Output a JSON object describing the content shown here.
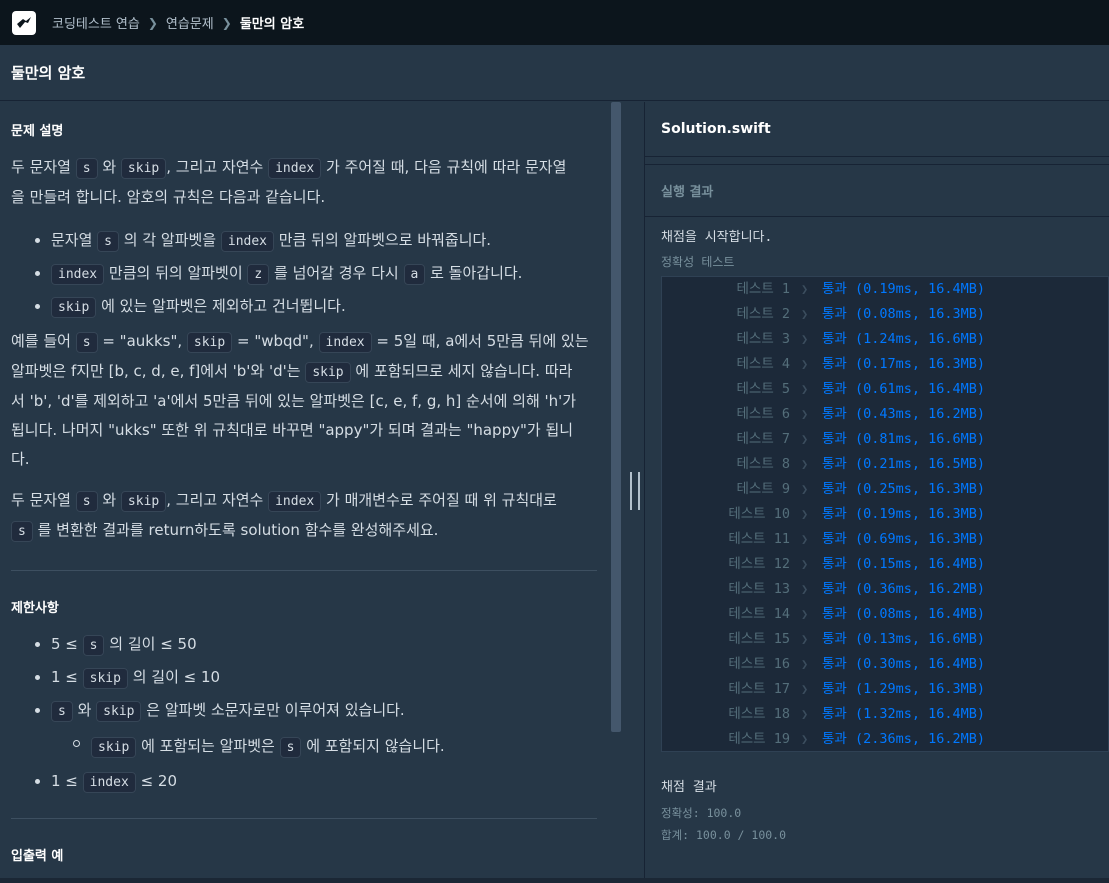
{
  "nav": {
    "crumbs": [
      "코딩테스트 연습",
      "연습문제",
      "둘만의 암호"
    ]
  },
  "title": "둘만의 암호",
  "problem": {
    "section_title": "문제 설명",
    "p1": [
      "두 문자열 ",
      "s",
      " 와 ",
      "skip",
      ", 그리고 자연수 ",
      "index",
      " 가 주어질 때, 다음 규칙에 따라 문자열",
      "을 만들려 합니다. 암호의 규칙은 다음과 같습니다."
    ],
    "rules": [
      [
        "문자열 ",
        "s",
        " 의 각 알파벳을 ",
        "index",
        " 만큼 뒤의 알파벳으로 바꿔줍니다."
      ],
      [
        "",
        "index",
        " 만큼의 뒤의 알파벳이 ",
        "z",
        " 를 넘어갈 경우 다시 ",
        "a",
        " 로 돌아갑니다."
      ],
      [
        "",
        "skip",
        " 에 있는 알파벳은 제외하고 건너뜁니다."
      ]
    ],
    "p2": [
      "예를 들어 ",
      "s",
      " = \"aukks\", ",
      "skip",
      " = \"wbqd\", ",
      "index",
      " = 5일 때, a에서 5만큼 뒤에 있는",
      "알파벳은 f지만 [b, c, d, e, f]에서 'b'와 'd'는 ",
      "skip",
      " 에 포함되므로 세지 않습니다. 따라",
      "서 'b', 'd'를 제외하고 'a'에서 5만큼 뒤에 있는 알파벳은 [c, e, f, g, h] 순서에 의해 'h'가",
      "됩니다. 나머지 \"ukks\" 또한 위 규칙대로 바꾸면 \"appy\"가 되며 결과는 \"happy\"가 됩니",
      "다."
    ],
    "p3": [
      "두 문자열 ",
      "s",
      " 와 ",
      "skip",
      ", 그리고 자연수 ",
      "index",
      " 가 매개변수로 주어질 때 위 규칙대로",
      "",
      "s",
      " 를 변환한 결과를 return하도록 solution 함수를 완성해주세요."
    ]
  },
  "constraints": {
    "section_title": "제한사항",
    "items": [
      [
        "5 ≤ ",
        "s",
        " 의 길이 ≤ 50"
      ],
      [
        "1 ≤ ",
        "skip",
        " 의 길이 ≤ 10"
      ],
      [
        "",
        "s",
        " 와 ",
        "skip",
        " 은 알파벳 소문자로만 이루어져 있습니다."
      ],
      [
        "",
        "skip",
        " 에 포함되는 알파벳은 ",
        "s",
        " 에 포함되지 않습니다."
      ],
      [
        "1 ≤ ",
        "index",
        " ≤ 20"
      ]
    ]
  },
  "io_title": "입출력 예",
  "editor": {
    "file_name": "Solution.swift",
    "run_label": "실행 결과",
    "start_msg": "채점을 시작합니다.",
    "acc_header": "정확성  테스트",
    "tests": [
      {
        "name": "테스트 1",
        "result": "통과 (0.19ms, 16.4MB)"
      },
      {
        "name": "테스트 2",
        "result": "통과 (0.08ms, 16.3MB)"
      },
      {
        "name": "테스트 3",
        "result": "통과 (1.24ms, 16.6MB)"
      },
      {
        "name": "테스트 4",
        "result": "통과 (0.17ms, 16.3MB)"
      },
      {
        "name": "테스트 5",
        "result": "통과 (0.61ms, 16.4MB)"
      },
      {
        "name": "테스트 6",
        "result": "통과 (0.43ms, 16.2MB)"
      },
      {
        "name": "테스트 7",
        "result": "통과 (0.81ms, 16.6MB)"
      },
      {
        "name": "테스트 8",
        "result": "통과 (0.21ms, 16.5MB)"
      },
      {
        "name": "테스트 9",
        "result": "통과 (0.25ms, 16.3MB)"
      },
      {
        "name": "테스트 10",
        "result": "통과 (0.19ms, 16.3MB)"
      },
      {
        "name": "테스트 11",
        "result": "통과 (0.69ms, 16.3MB)"
      },
      {
        "name": "테스트 12",
        "result": "통과 (0.15ms, 16.4MB)"
      },
      {
        "name": "테스트 13",
        "result": "통과 (0.36ms, 16.2MB)"
      },
      {
        "name": "테스트 14",
        "result": "통과 (0.08ms, 16.4MB)"
      },
      {
        "name": "테스트 15",
        "result": "통과 (0.13ms, 16.6MB)"
      },
      {
        "name": "테스트 16",
        "result": "통과 (0.30ms, 16.4MB)"
      },
      {
        "name": "테스트 17",
        "result": "통과 (1.29ms, 16.3MB)"
      },
      {
        "name": "테스트 18",
        "result": "통과 (1.32ms, 16.4MB)"
      },
      {
        "name": "테스트 19",
        "result": "통과 (2.36ms, 16.2MB)"
      }
    ],
    "summary_title": "채점 결과",
    "accuracy": "정확성: 100.0",
    "total": "합계: 100.0 / 100.0"
  }
}
